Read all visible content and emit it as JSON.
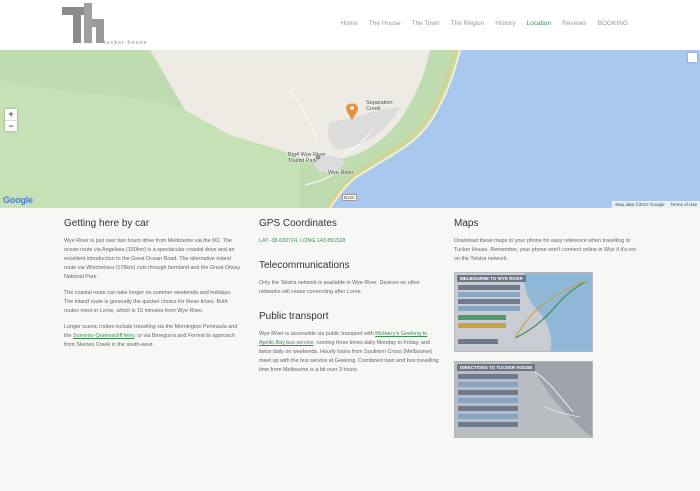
{
  "header": {
    "logo_text": "tucker house",
    "nav": [
      {
        "label": "Home",
        "active": false
      },
      {
        "label": "The House",
        "active": false
      },
      {
        "label": "The Town",
        "active": false
      },
      {
        "label": "The Region",
        "active": false
      },
      {
        "label": "History",
        "active": false
      },
      {
        "label": "Location",
        "active": true
      },
      {
        "label": "Reviews",
        "active": false
      },
      {
        "label": "BOOKING",
        "active": false
      }
    ]
  },
  "map": {
    "zoom_in": "+",
    "zoom_out": "−",
    "labels": {
      "separation_creek": "Separation Creek",
      "caravan_park": "Big4 Wye River Tourist Park",
      "wye_river": "Wye River",
      "road": "B100"
    },
    "google": "Google",
    "map_data": "Map data ©2017 Google",
    "terms": "Terms of Use"
  },
  "col1": {
    "title": "Getting here by car",
    "p1": "Wye River is just over two hours drive from Melbourne via the M1. The ocean route via Angelsea (150km) is a spectacular coastal drive and an excellent introduction to the Great Ocean Road. The alternative inland route via Winchelsea (178km) cuts through farmland and the Great Otway National Park.",
    "p2": "The coastal route can take longer on summer weekends and holidays. The inland route is generally the quicker choice for these times. Both routes meet in Lorne, which is 15 minutes from Wye River.",
    "p3_before": "Longer scenic routes include travelling via the Mornington Peninsula and the ",
    "p3_link": "Sorrento-Queenscliff ferry",
    "p3_after": ", or via Birregurra and Forrest to approach from Skenes Creek in the south-west."
  },
  "col2": {
    "gps_title": "GPS Coordinates",
    "gps_value": "LAT -38.630724, LONG 143.891528",
    "tele_title": "Telecommunications",
    "tele_text": "Only the Telstra network is available in Wye River. Devices on other networks will cease connecting after Lorne.",
    "transport_title": "Public transport",
    "transport_before": "Wye River is accessible via public transport with ",
    "transport_link": "McHarry's Geelong to Apollo Bay bus service",
    "transport_after": ", running three times daily Monday to Friday, and twice daily on weekends. Hourly trains from Southern Cross (Melbourne) meet up with the bus service at Geelong. Combined train and bus travelling time from Melbourne is a bit over 3 hours."
  },
  "col3": {
    "title": "Maps",
    "text": "Download these maps to your phone for easy reference when travelling to Tucker House. Remember, your phone won't connect online in Wye if it's not on the Telstra network.",
    "thumb1_title": "MELBOURNE TO WYE RIVER",
    "thumb2_title": "DIRECTIONS TO TUCKER HOUSE"
  }
}
